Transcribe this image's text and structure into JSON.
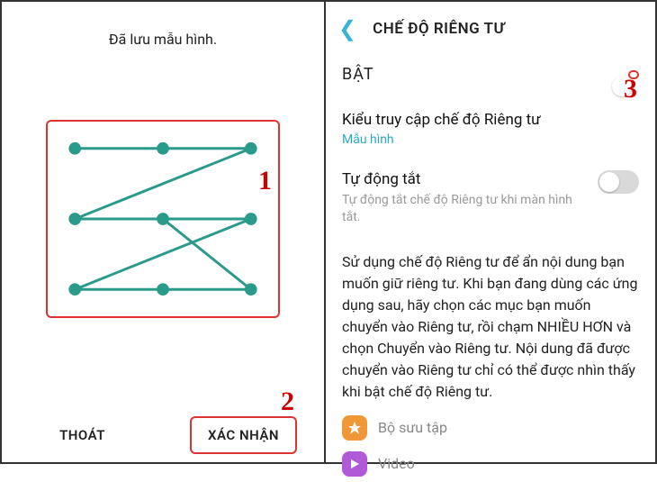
{
  "left": {
    "saved_text": "Đã lưu mẫu hình.",
    "exit_label": "THOÁT",
    "confirm_label": "XÁC NHẬN"
  },
  "right": {
    "header_title": "CHẾ ĐỘ RIÊNG TƯ",
    "main_toggle_label": "BẬT",
    "access_title": "Kiểu truy cập chế độ Riêng tư",
    "access_value": "Mẫu hình",
    "auto_off_title": "Tự động tắt",
    "auto_off_desc": "Tự động tắt chế độ Riêng tư khi màn hình tắt.",
    "description": "Sử dụng chế độ Riêng tư để ẩn nội dung bạn muốn giữ riêng tư. Khi bạn đang dùng các ứng dụng sau, hãy chọn các mục bạn muốn chuyển vào Riêng tư, rồi chạm NHIỀU HƠN và chọn Chuyển vào Riêng tư. Nội dung đã được chuyển vào Riêng tư chỉ có thể được nhìn thấy khi bật chế độ Riêng tư.",
    "apps": {
      "gallery": "Bộ sưu tập",
      "video": "Video"
    }
  },
  "annotations": {
    "one": "1",
    "two": "2",
    "three": "3"
  }
}
